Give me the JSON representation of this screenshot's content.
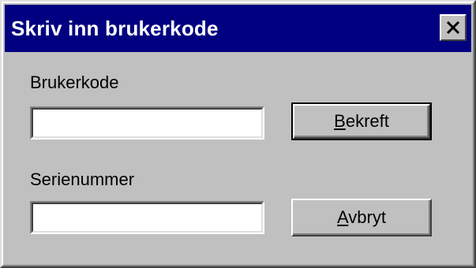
{
  "window": {
    "title": "Skriv inn brukerkode",
    "close_icon": "close-icon",
    "titlebar_color": "#000080",
    "face_color": "#c0c0c0"
  },
  "form": {
    "user_code": {
      "label": "Brukerkode",
      "value": "",
      "placeholder": ""
    },
    "serial_number": {
      "label": "Serienummer",
      "value": "",
      "placeholder": ""
    }
  },
  "buttons": {
    "confirm": {
      "mnemonic": "B",
      "rest": "ekreft",
      "is_default": true
    },
    "cancel": {
      "mnemonic": "A",
      "rest": "vbryt",
      "is_default": false
    }
  }
}
